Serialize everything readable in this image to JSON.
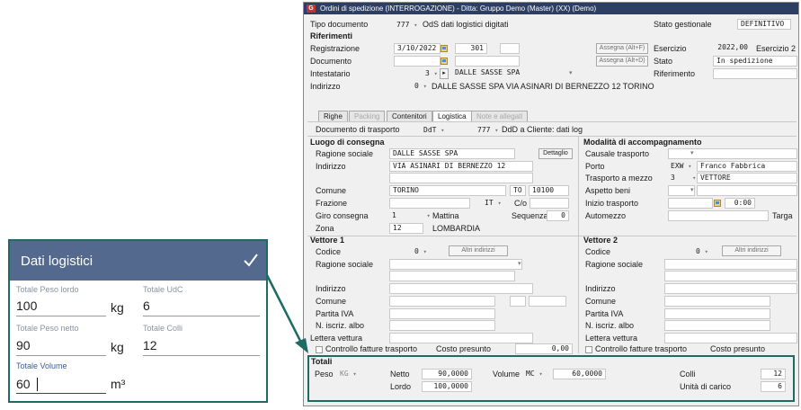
{
  "window": {
    "title": "Ordini di spedizione (INTERROGAZIONE) - Ditta: Gruppo Demo (Master) (XX) (Demo)",
    "app_icon": "G"
  },
  "header": {
    "tipo_documento_label": "Tipo documento",
    "tipo_documento_code": "777",
    "tipo_documento_desc": "OdS dati logistici digitati",
    "stato_gestionale_label": "Stato gestionale",
    "stato_gestionale_value": "DEFINITIVO",
    "riferimenti_label": "Riferimenti",
    "registrazione_label": "Registrazione",
    "registrazione_date": "3/10/2022",
    "registrazione_num": "301",
    "assegna_f_label": "Assegna (Alt+F)",
    "esercizio_label": "Esercizio",
    "esercizio_value": "2022,00",
    "esercizio2_label": "Esercizio 2",
    "documento_label": "Documento",
    "assegna_d_label": "Assegna (Alt+D)",
    "stato_label": "Stato",
    "stato_value": "In spedizione",
    "intestatario_label": "Intestatario",
    "intestatario_code": "3",
    "intestatario_name": "DALLE SASSE SPA",
    "riferimento_label": "Riferimento",
    "indirizzo_label": "Indirizzo",
    "indirizzo_code": "0",
    "indirizzo_value": "DALLE SASSE SPA VIA ASINARI DI BERNEZZO 12 TORINO"
  },
  "tabs": [
    {
      "label": "Righe",
      "state": "normal"
    },
    {
      "label": "Packing",
      "state": "disabled"
    },
    {
      "label": "Contenitori",
      "state": "normal"
    },
    {
      "label": "Logistica",
      "state": "active"
    },
    {
      "label": "Note e allegati",
      "state": "disabled"
    }
  ],
  "logistica": {
    "doc_trasporto_label": "Documento di trasporto",
    "doc_trasporto_type": "DdT",
    "doc_trasporto_code": "777",
    "doc_trasporto_desc": "DdD a Cliente: dati log",
    "luogo_consegna_label": "Luogo di consegna",
    "ragione_sociale_label": "Ragione sociale",
    "ragione_sociale_value": "DALLE SASSE SPA",
    "dettaglio_label": "Dettaglio",
    "indirizzo_label": "Indirizzo",
    "indirizzo_value": "VIA ASINARI DI BERNEZZO 12",
    "comune_label": "Comune",
    "comune_value": "TORINO",
    "provincia_value": "TO",
    "cap_value": "10100",
    "frazione_label": "Frazione",
    "nazione_value": "IT",
    "co_label": "C/o",
    "giro_consegna_label": "Giro consegna",
    "giro_consegna_code": "1",
    "giro_consegna_desc": "Mattina",
    "sequenza_label": "Sequenza",
    "sequenza_value": "0",
    "zona_label": "Zona",
    "zona_code": "12",
    "zona_desc": "LOMBARDIA",
    "modalita_label": "Modalità di accompagnamento",
    "causale_trasporto_label": "Causale trasporto",
    "porto_label": "Porto",
    "porto_code": "EXW",
    "porto_desc": "Franco Fabbrica",
    "trasporto_mezzo_label": "Trasporto a mezzo",
    "trasporto_mezzo_code": "3",
    "trasporto_mezzo_desc": "VETTORE",
    "aspetto_beni_label": "Aspetto beni",
    "inizio_trasporto_label": "Inizio trasporto",
    "inizio_trasporto_time": "0:00",
    "automezzo_label": "Automezzo",
    "targa_label": "Targa"
  },
  "vettore1": {
    "title": "Vettore 1",
    "codice_label": "Codice",
    "codice_value": "0",
    "altri_indirizzi_label": "Altri indirizzi",
    "ragione_sociale_label": "Ragione sociale",
    "indirizzo_label": "Indirizzo",
    "comune_label": "Comune",
    "partita_iva_label": "Partita IVA",
    "iscriz_albo_label": "N. iscriz. albo",
    "lettera_vettura_label": "Lettera vettura",
    "controllo_fatture_label": "Controllo fatture trasporto",
    "costo_presunto_label": "Costo presunto",
    "costo_presunto_value": "0,00"
  },
  "vettore2": {
    "title": "Vettore 2",
    "codice_label": "Codice",
    "codice_value": "0",
    "altri_indirizzi_label": "Altri indirizzi",
    "ragione_sociale_label": "Ragione sociale",
    "indirizzo_label": "Indirizzo",
    "comune_label": "Comune",
    "partita_iva_label": "Partita IVA",
    "iscriz_albo_label": "N. iscriz. albo",
    "lettera_vettura_label": "Lettera vettura",
    "controllo_fatture_label": "Controllo fatture trasporto",
    "costo_presunto_label": "Costo presunto"
  },
  "totali": {
    "title": "Totali",
    "peso_label": "Peso",
    "peso_unit": "KG",
    "netto_label": "Netto",
    "netto_value": "90,0000",
    "lordo_label": "Lordo",
    "lordo_value": "100,0000",
    "volume_label": "Volume",
    "volume_unit": "MC",
    "volume_value": "60,0000",
    "colli_label": "Colli",
    "colli_value": "12",
    "udc_label": "Unità di carico",
    "udc_value": "6"
  },
  "card": {
    "title": "Dati logistici",
    "peso_lordo_label": "Totale Peso lordo",
    "peso_lordo_value": "100",
    "peso_lordo_unit": "kg",
    "udc_label": "Totale UdC",
    "udc_value": "6",
    "peso_netto_label": "Totale Peso netto",
    "peso_netto_value": "90",
    "peso_netto_unit": "kg",
    "colli_label": "Totale Colli",
    "colli_value": "12",
    "volume_label": "Totale Volume",
    "volume_value": "60",
    "volume_unit": "m³"
  },
  "colors": {
    "titlebar": "#2c3e63",
    "highlight": "#1d6b63",
    "card_header": "#53698d"
  }
}
